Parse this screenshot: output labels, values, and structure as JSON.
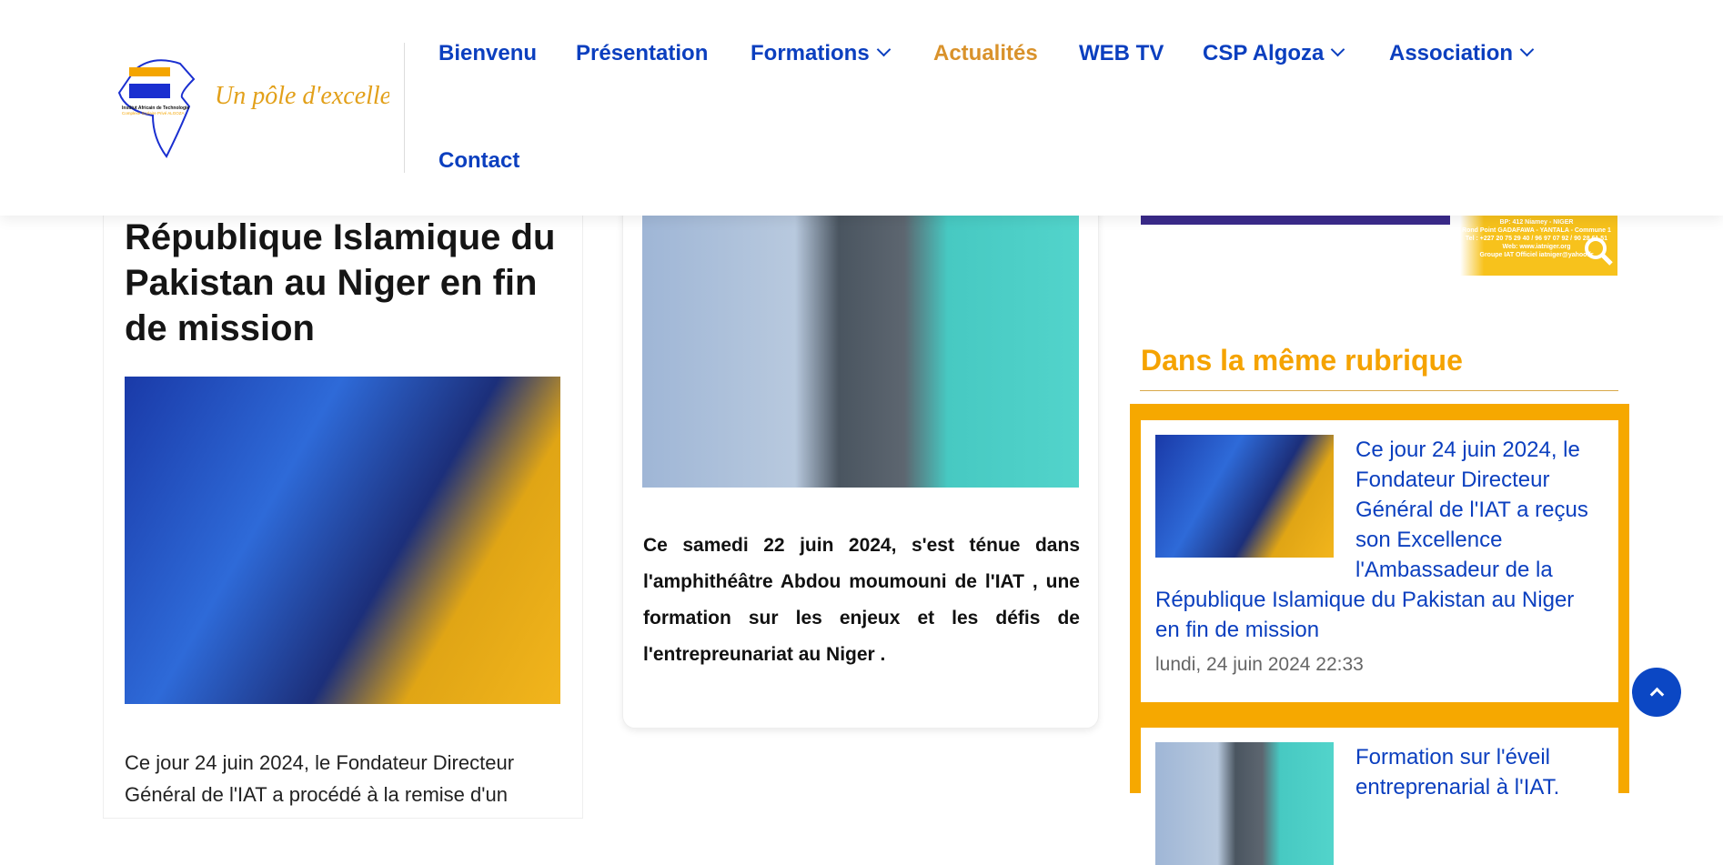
{
  "logo": {
    "org": "Institut Africain de Technologie",
    "sub": "Complexe Scolaire Privé ALGOZA",
    "slogan": "Un pôle d'excellence"
  },
  "nav": [
    {
      "label": "Bienvenu"
    },
    {
      "label": "Présentation"
    },
    {
      "label": "Formations",
      "dropdown": true
    },
    {
      "label": "Actualités",
      "active": true
    },
    {
      "label": "WEB TV"
    },
    {
      "label": "CSP Algoza",
      "dropdown": true
    },
    {
      "label": "Association",
      "dropdown": true
    },
    {
      "label": "Contact"
    }
  ],
  "left_article": {
    "title": "République Islamique du Pakistan au Niger en fin de mission",
    "excerpt_line1": "Ce jour 24 juin 2024, le Fondateur Directeur",
    "excerpt_line2": "Général de l'IAT a procédé à la remise d'un"
  },
  "middle_article": {
    "text": "Ce samedi 22 juin 2024, s'est ténue dans l'amphithéâtre Abdou moumouni de l'IAT , une formation sur les enjeux et les défis de l'entrepreunariat au Niger ."
  },
  "banner": {
    "address": "BP: 412 Niamey - NIGER",
    "street": "Rond Point GADAFAWA - YANTALA - Commune 1",
    "tel": "Tel : +227 20 75 29 40 / 96 97 07 92 / 90 28 61 51",
    "web": "Web: www.iatniger.org",
    "facebook": "Groupe IAT Officiel",
    "email": "iatniger@yahoo.fr"
  },
  "sidebar": {
    "heading": "Dans la même rubrique",
    "items": [
      {
        "title": "Ce jour 24 juin 2024, le Fondateur Directeur Général de l'IAT a reçus son Excellence l'Ambassadeur de la République Islamique du Pakistan au Niger en fin de mission",
        "date": "lundi, 24 juin 2024 22:33"
      },
      {
        "title": "Formation sur l'éveil entreprenarial à l'IAT."
      }
    ]
  },
  "colors": {
    "nav": "#0b3fbf",
    "active": "#d9922b",
    "accent": "#f6a800"
  },
  "icons": {
    "search": "search-icon",
    "scroll_top": "chevron-up-icon"
  }
}
